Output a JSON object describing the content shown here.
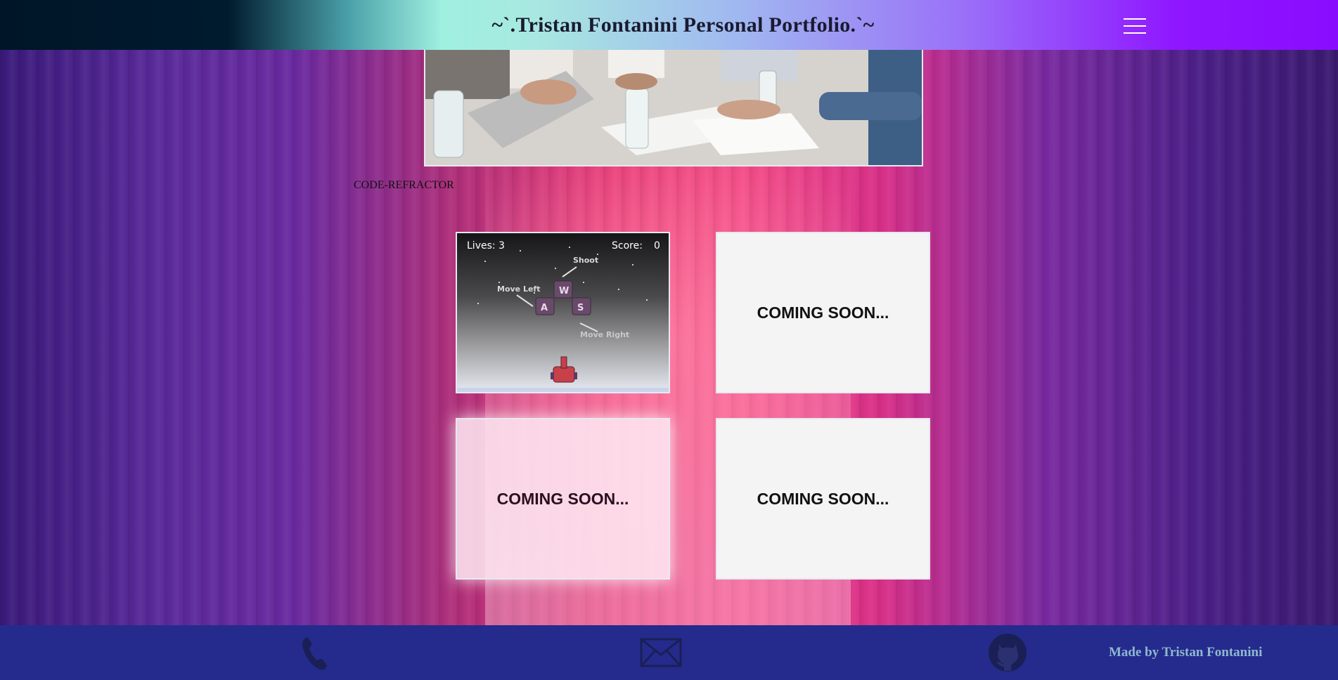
{
  "header": {
    "title": "~`.Tristan Fontanini Personal Portfolio.`~",
    "menu_icon": "hamburger-menu-icon"
  },
  "section": {
    "label": "CODE-REFRACTOR"
  },
  "projects": [
    {
      "type": "game-screenshot",
      "hud_lives": "Lives: 3",
      "hud_score_label": "Score:",
      "hud_score_value": "0",
      "hint_shoot": "Shoot",
      "hint_left": "Move Left",
      "hint_right": "Move Right",
      "key_up": "W",
      "key_left": "A",
      "key_right": "S"
    },
    {
      "label": "COMING SOON..."
    },
    {
      "label": "COMING SOON..."
    },
    {
      "label": "COMING SOON..."
    }
  ],
  "footer": {
    "icons": [
      "phone-icon",
      "mail-icon",
      "github-icon"
    ],
    "credit": "Made by Tristan Fontanini"
  },
  "colors": {
    "footer_bg": "#252b8c",
    "credit_text": "#8fb8d0",
    "header_right": "#8a0cff"
  }
}
